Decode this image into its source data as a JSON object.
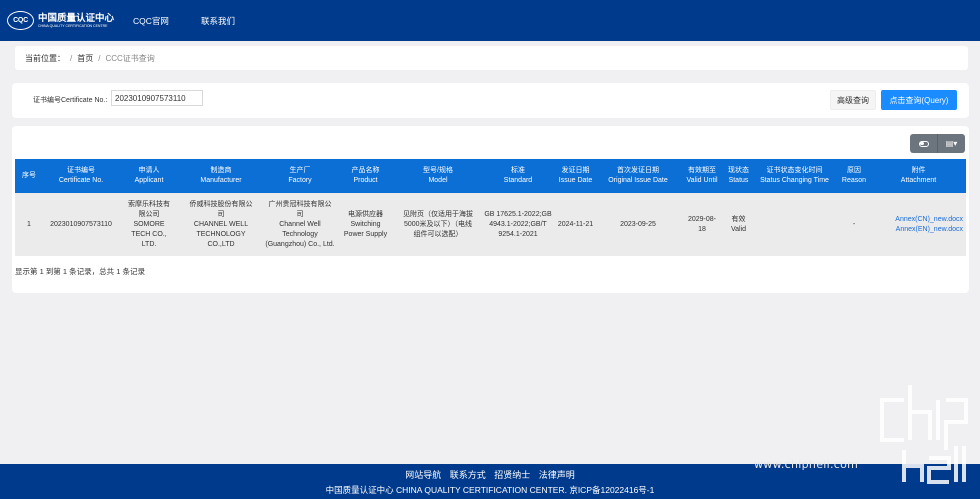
{
  "header": {
    "logo_mark": "CQC",
    "logo_cn": "中国质量认证中心",
    "logo_en": "CHINA QUALITY CERTIFICATION CENTRE",
    "nav": [
      "CQC官网",
      "联系我们"
    ]
  },
  "breadcrumb": {
    "prefix": "当前位置：",
    "home": "首页",
    "current": "CCC证书查询"
  },
  "search": {
    "label": "证书编号Certificate No.:",
    "value": "2023010907573110",
    "advanced_label": "高级查询",
    "query_label": "点击查询(Query)"
  },
  "table": {
    "columns": [
      [
        "序号"
      ],
      [
        "证书编号",
        "Certificate No."
      ],
      [
        "申请人",
        "Applicant"
      ],
      [
        "制造商",
        "Manufacturer"
      ],
      [
        "生产厂",
        "Factory"
      ],
      [
        "产品名称",
        "Product"
      ],
      [
        "型号/规格",
        "Model"
      ],
      [
        "标准",
        "Standard"
      ],
      [
        "发证日期",
        "Issue Date"
      ],
      [
        "首次发证日期",
        "Original Issue Date"
      ],
      [
        "有效期至",
        "Valid Until"
      ],
      [
        "现状态",
        "Status"
      ],
      [
        "证书状态变化时间",
        "Status Changing Time"
      ],
      [
        "原因",
        "Reason"
      ],
      [
        "附件",
        "Attachment"
      ]
    ],
    "row": {
      "index": "1",
      "cert_no": "2023010907573110",
      "applicant": [
        "索摩乐科技有",
        "限公司",
        "SOMORE",
        "TECH CO.,",
        "LTD."
      ],
      "manufacturer": [
        "侨威科技股份有限公",
        "司",
        "CHANNEL WELL",
        "TECHNOLOGY",
        "CO.,LTD"
      ],
      "factory": [
        "广州贵冠科技有限公",
        "司",
        "Channel Well",
        "Technology",
        "(Guangzhou) Co., Ltd."
      ],
      "product": [
        "电源供应器",
        "Switching",
        "Power Supply"
      ],
      "model": [
        "见附页（仅适用于海拔",
        "5000米及以下）（电线",
        "组件可以选配）"
      ],
      "standard": [
        "GB 17625.1-2022;GB",
        "4943.1-2022;GB/T",
        "9254.1-2021"
      ],
      "issue_date": "2024-11-21",
      "original_issue_date": "2023-09-25",
      "valid_until": [
        "2029-08-",
        "18"
      ],
      "status": [
        "有效",
        "Valid"
      ],
      "status_change_time": "",
      "reason": "-",
      "attachments": [
        "Annex(CN)_new.docx",
        "Annex(EN)_new.docx"
      ]
    },
    "summary": "显示第 1 到第 1 条记录，总共 1 条记录"
  },
  "footer": {
    "links": [
      "网站导航",
      "联系方式",
      "招贤纳士",
      "法律声明"
    ],
    "copyright": "中国质量认证中心 CHINA QUALITY CERTIFICATION CENTER.  京ICP备12022416号-1"
  },
  "watermark": {
    "url": "www.chiphell.com",
    "logo_text": "chip hell"
  },
  "colors": {
    "header_bg": "#003a8c",
    "table_header_bg": "#0b6fd6",
    "primary_button": "#1a8cff",
    "row_bg": "#ebebeb"
  }
}
